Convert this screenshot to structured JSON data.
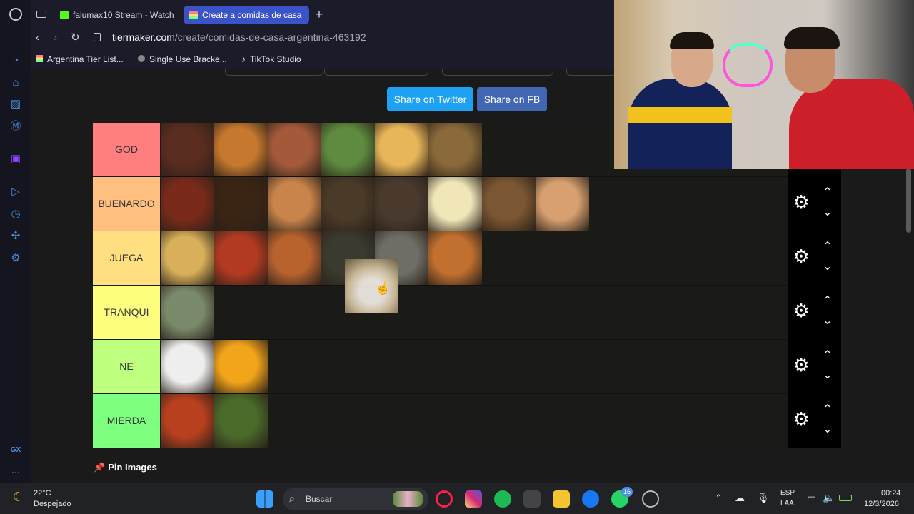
{
  "browser": {
    "tabs": [
      {
        "label": "falumax10 Stream - Watch",
        "active": false
      },
      {
        "label": "Create a comidas de casa",
        "active": true
      }
    ],
    "new_tab": "+",
    "url_domain": "tiermaker.com",
    "url_path": "/create/comidas-de-casa-argentina-463192",
    "bookmarks": [
      "Argentina Tier List...",
      "Single Use Bracke...",
      "TikTok Studio"
    ]
  },
  "sidebar": {
    "bottom_label": "GX",
    "more": "···"
  },
  "share": {
    "twitter": "Share on Twitter",
    "fb": "Share on FB"
  },
  "tiers": [
    {
      "label": "GOD",
      "color": "#ff7f7f",
      "items": 6
    },
    {
      "label": "BUENARDO",
      "color": "#ffbf7f",
      "items": 8
    },
    {
      "label": "JUEGA",
      "color": "#ffdf7f",
      "items": 6
    },
    {
      "label": "TRANQUI",
      "color": "#ffff7f",
      "items": 1
    },
    {
      "label": "NE",
      "color": "#bfff7f",
      "items": 2
    },
    {
      "label": "MIERDA",
      "color": "#7fff7f",
      "items": 2
    }
  ],
  "pin_images": "Pin Images",
  "taskbar": {
    "weather_temp": "22°C",
    "weather_desc": "Despejado",
    "search_placeholder": "Buscar",
    "whatsapp_badge": "16",
    "lang_top": "ESP",
    "lang_bottom": "LAA",
    "time": "00:24",
    "date": "12/3/2026"
  },
  "colors": {
    "accent": "#4a90e2",
    "twitter": "#1da1f2",
    "fb": "#4267b2"
  }
}
